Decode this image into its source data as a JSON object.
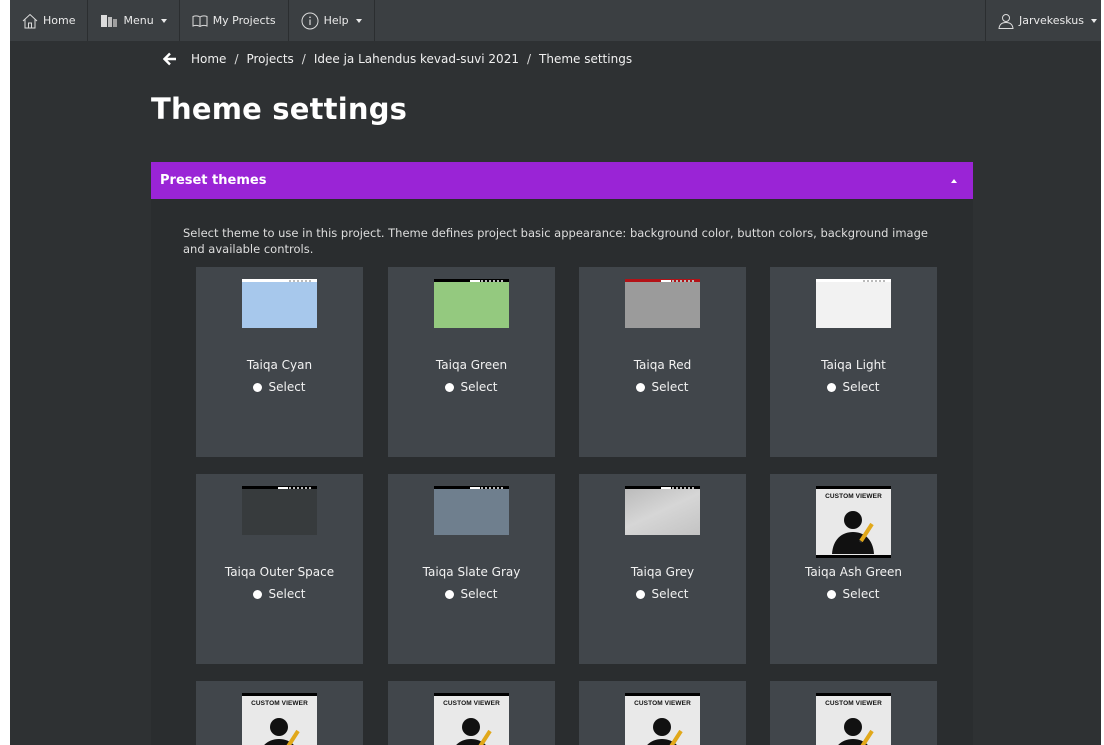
{
  "topbar": {
    "home": "Home",
    "menu": "Menu",
    "my_projects": "My Projects",
    "help": "Help",
    "user": "Jarvekeskus"
  },
  "breadcrumb": {
    "home": "Home",
    "projects": "Projects",
    "project": "Idee ja Lahendus kevad-suvi 2021",
    "current": "Theme settings",
    "sep": "/"
  },
  "page": {
    "title": "Theme settings"
  },
  "panel": {
    "title": "Preset themes",
    "description": "Select theme to use in this project. Theme defines project basic appearance: background color, button colors, background image and available controls."
  },
  "custom_viewer_label": "CUSTOM VIEWER",
  "themes": [
    {
      "name": "Taiqa Cyan",
      "select": "Select",
      "color": "#a7c8ec",
      "bar": "#ffffff"
    },
    {
      "name": "Taiqa Green",
      "select": "Select",
      "color": "#94c97f",
      "bar": "#000000"
    },
    {
      "name": "Taiqa Red",
      "select": "Select",
      "color": "#9b9b9b",
      "bar": "#b31217"
    },
    {
      "name": "Taiqa Light",
      "select": "Select",
      "color": "#f2f2f2",
      "bar": "#ffffff"
    },
    {
      "name": "Taiqa Outer Space",
      "select": "Select",
      "color": "#373b3d",
      "bar": "#000000"
    },
    {
      "name": "Taiqa Slate Gray",
      "select": "Select",
      "color": "#6f7f8e",
      "bar": "#000000"
    },
    {
      "name": "Taiqa Grey",
      "select": "Select",
      "color": "#c9c9c9",
      "bar": "#000000"
    },
    {
      "name": "Taiqa Ash Green",
      "select": "Select",
      "color": "#e9e9e9",
      "bar": "#000000"
    }
  ]
}
